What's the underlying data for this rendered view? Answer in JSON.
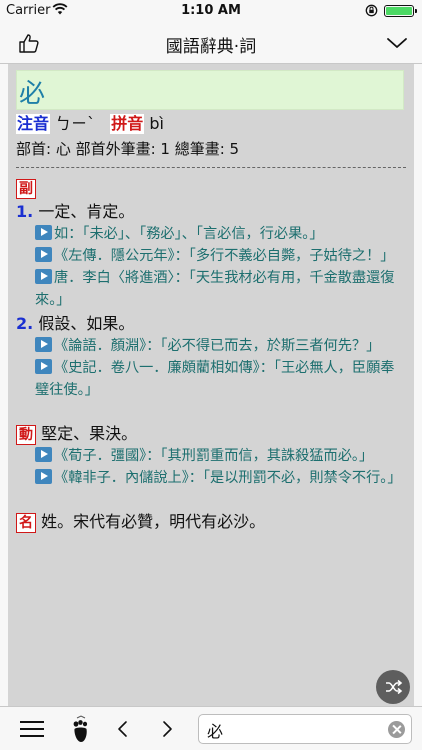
{
  "status_bar": {
    "carrier": "Carrier",
    "time": "1:10 AM"
  },
  "nav": {
    "title": "國語辭典·詞"
  },
  "entry": {
    "headword": "必",
    "zhuyin_label": "注音",
    "zhuyin": "ㄅㄧˋ",
    "pinyin_label": "拼音",
    "pinyin": "bì",
    "radical_info": "部首: 心   部首外筆畫: 1   總筆畫: 5"
  },
  "senses": [
    {
      "pos": "副",
      "defs": [
        {
          "num": "1.",
          "text": "一定、肯定。",
          "examples": [
            "如：「未必」、「務必」、「言必信，行必果。」",
            "《左傳．隱公元年》：「多行不義必自斃，子姑待之！」",
            "唐．李白〈將進酒〉：「天生我材必有用，千金散盡還復來。」"
          ]
        },
        {
          "num": "2.",
          "text": "假設、如果。",
          "examples": [
            "《論語．顏淵》：「必不得已而去，於斯三者何先？」",
            "《史記．卷八一．廉頗藺相如傳》：「王必無人，臣願奉璧往使。」"
          ]
        }
      ]
    },
    {
      "pos": "動",
      "text": "堅定、果決。",
      "examples": [
        "《荀子．彊國》：「其刑罰重而信，其誅殺猛而必。」",
        "《韓非子．內儲說上》：「是以刑罰不必，則禁令不行。」"
      ]
    },
    {
      "pos": "名",
      "text": "姓。宋代有必贊，明代有必沙。"
    }
  ],
  "search": {
    "value": "必"
  },
  "colors": {
    "zhuyin_badge": "#1a2fd1",
    "pinyin_badge": "#d01818",
    "headword": "#1f7fa8",
    "headword_bg": "#e0f6d5",
    "example_text": "#1d6f6f",
    "play_icon": "#3f86bd",
    "content_bg": "#d4d4d4"
  },
  "icons": {
    "nav_left": "thumbs-up-icon",
    "nav_right": "chevron-down-icon",
    "play": "play-icon",
    "shuffle": "shuffle-icon",
    "menu": "hamburger-menu-icon",
    "history": "footprint-icon",
    "back": "chevron-left-icon",
    "forward": "chevron-right-icon",
    "clear": "clear-circle-icon"
  }
}
